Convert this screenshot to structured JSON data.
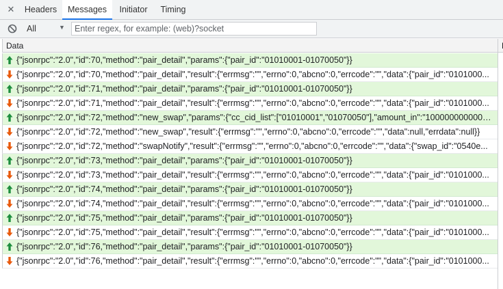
{
  "tabs": {
    "items": [
      {
        "label": "Headers",
        "active": false
      },
      {
        "label": "Messages",
        "active": true
      },
      {
        "label": "Initiator",
        "active": false
      },
      {
        "label": "Timing",
        "active": false
      }
    ]
  },
  "filter": {
    "type_selected": "All",
    "placeholder": "Enter regex, for example: (web)?socket",
    "value": ""
  },
  "table": {
    "columns": [
      "Data",
      "L"
    ],
    "rows": [
      {
        "dir": "send",
        "text": "{\"jsonrpc\":\"2.0\",\"id\":70,\"method\":\"pair_detail\",\"params\":{\"pair_id\":\"01010001-01070050\"}}"
      },
      {
        "dir": "recv",
        "text": "{\"jsonrpc\":\"2.0\",\"id\":70,\"method\":\"pair_detail\",\"result\":{\"errmsg\":\"\",\"errno\":0,\"abcno\":0,\"errcode\":\"\",\"data\":{\"pair_id\":\"0101000..."
      },
      {
        "dir": "send",
        "text": "{\"jsonrpc\":\"2.0\",\"id\":71,\"method\":\"pair_detail\",\"params\":{\"pair_id\":\"01010001-01070050\"}}"
      },
      {
        "dir": "recv",
        "text": "{\"jsonrpc\":\"2.0\",\"id\":71,\"method\":\"pair_detail\",\"result\":{\"errmsg\":\"\",\"errno\":0,\"abcno\":0,\"errcode\":\"\",\"data\":{\"pair_id\":\"0101000..."
      },
      {
        "dir": "send",
        "text": "{\"jsonrpc\":\"2.0\",\"id\":72,\"method\":\"new_swap\",\"params\":{\"cc_cid_list\":[\"01010001\",\"01070050\"],\"amount_in\":\"1000000000000..."
      },
      {
        "dir": "recv",
        "text": "{\"jsonrpc\":\"2.0\",\"id\":72,\"method\":\"new_swap\",\"result\":{\"errmsg\":\"\",\"errno\":0,\"abcno\":0,\"errcode\":\"\",\"data\":null,\"errdata\":null}}"
      },
      {
        "dir": "recv",
        "text": "{\"jsonrpc\":\"2.0\",\"id\":72,\"method\":\"swapNotify\",\"result\":{\"errmsg\":\"\",\"errno\":0,\"abcno\":0,\"errcode\":\"\",\"data\":{\"swap_id\":\"0540e..."
      },
      {
        "dir": "send",
        "text": "{\"jsonrpc\":\"2.0\",\"id\":73,\"method\":\"pair_detail\",\"params\":{\"pair_id\":\"01010001-01070050\"}}"
      },
      {
        "dir": "recv",
        "text": "{\"jsonrpc\":\"2.0\",\"id\":73,\"method\":\"pair_detail\",\"result\":{\"errmsg\":\"\",\"errno\":0,\"abcno\":0,\"errcode\":\"\",\"data\":{\"pair_id\":\"0101000..."
      },
      {
        "dir": "send",
        "text": "{\"jsonrpc\":\"2.0\",\"id\":74,\"method\":\"pair_detail\",\"params\":{\"pair_id\":\"01010001-01070050\"}}"
      },
      {
        "dir": "recv",
        "text": "{\"jsonrpc\":\"2.0\",\"id\":74,\"method\":\"pair_detail\",\"result\":{\"errmsg\":\"\",\"errno\":0,\"abcno\":0,\"errcode\":\"\",\"data\":{\"pair_id\":\"0101000..."
      },
      {
        "dir": "send",
        "text": "{\"jsonrpc\":\"2.0\",\"id\":75,\"method\":\"pair_detail\",\"params\":{\"pair_id\":\"01010001-01070050\"}}"
      },
      {
        "dir": "recv",
        "text": "{\"jsonrpc\":\"2.0\",\"id\":75,\"method\":\"pair_detail\",\"result\":{\"errmsg\":\"\",\"errno\":0,\"abcno\":0,\"errcode\":\"\",\"data\":{\"pair_id\":\"0101000..."
      },
      {
        "dir": "send",
        "text": "{\"jsonrpc\":\"2.0\",\"id\":76,\"method\":\"pair_detail\",\"params\":{\"pair_id\":\"01010001-01070050\"}}"
      },
      {
        "dir": "recv",
        "text": "{\"jsonrpc\":\"2.0\",\"id\":76,\"method\":\"pair_detail\",\"result\":{\"errmsg\":\"\",\"errno\":0,\"abcno\":0,\"errcode\":\"\",\"data\":{\"pair_id\":\"0101000..."
      }
    ]
  },
  "colors": {
    "send_row_bg": "#e2f7da",
    "send_arrow": "#1e8e3e",
    "recv_arrow": "#e8590c",
    "active_tab_accent": "#1a73e8"
  },
  "icons": {
    "close": "close-icon",
    "clear": "block-icon",
    "send": "arrow-up-icon",
    "receive": "arrow-down-icon"
  }
}
